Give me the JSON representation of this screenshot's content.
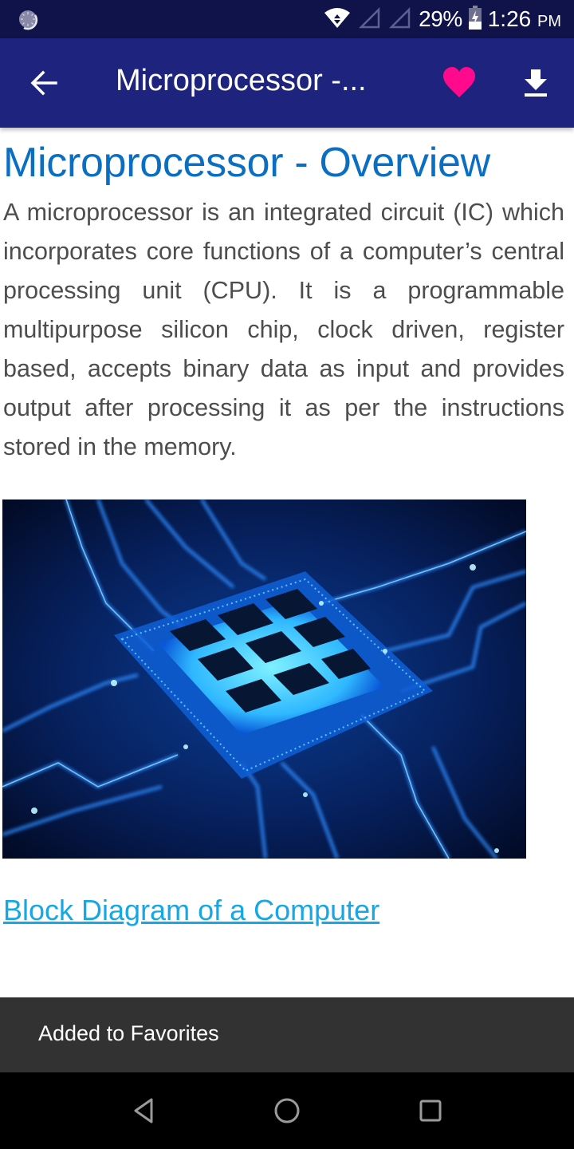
{
  "status_bar": {
    "notification_icon": "loading-circle-icon",
    "wifi_icon": "wifi-data-icon",
    "signal_icons": [
      "signal-empty-icon",
      "signal-empty-icon"
    ],
    "battery_percent": "29%",
    "battery_icon": "battery-charging-icon",
    "time": "1:26",
    "ampm": "PM"
  },
  "app_bar": {
    "back_icon": "arrow-back-icon",
    "title": "Microprocessor -...",
    "favorite_icon": "heart-icon",
    "download_icon": "download-icon",
    "favorite_color": "#ff0a8c",
    "background_color": "#1e237e"
  },
  "article": {
    "heading": "Microprocessor - Overview",
    "paragraph": "A microprocessor is an integrated circuit (IC) which incorporates core functions of a computer’s central processing unit (CPU). It is a programmable multipurpose silicon chip, clock driven, register based, accepts binary data as input and provides output after processing it as per the instructions stored in the memory.",
    "image_description": "Glowing blue microprocessor chip on circuit board",
    "link_text": "Block Diagram of a Computer",
    "heading_color": "#0a6fc2",
    "link_color": "#17a7e3"
  },
  "snackbar": {
    "message": "Added to Favorites"
  },
  "nav_bar": {
    "back": "nav-back-icon",
    "home": "nav-home-icon",
    "recents": "nav-recents-icon"
  }
}
